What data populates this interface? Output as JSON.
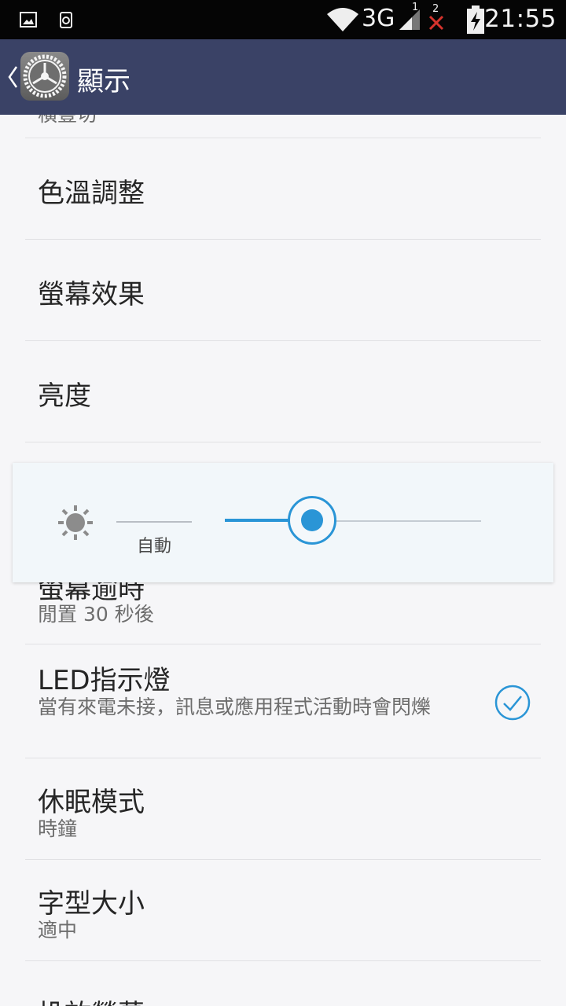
{
  "status_bar": {
    "network": "3G",
    "sim2_badge": "2",
    "signal_badge": "1",
    "time": "21:55"
  },
  "app_bar": {
    "title": "顯示"
  },
  "settings": {
    "partial_top_label": "橫豎切",
    "color_temp": {
      "title": "色溫調整"
    },
    "screen_effect": {
      "title": "螢幕效果"
    },
    "brightness": {
      "title": "亮度"
    },
    "screen_timeout": {
      "title": "螢幕逾時",
      "summary": "閒置 30 秒後"
    },
    "led": {
      "title": "LED指示燈",
      "summary": "當有來電未接，訊息或應用程式活動時會閃爍",
      "checked": true
    },
    "daydream": {
      "title": "休眠模式",
      "summary": "時鐘"
    },
    "font_size": {
      "title": "字型大小",
      "summary": "適中"
    },
    "partial_bottom_label": "投放螢幕"
  },
  "brightness_dialog": {
    "auto_label": "自動",
    "level_fraction": 0.34
  },
  "colors": {
    "app_bar": "#3a4266",
    "accent": "#2a95d6",
    "status_bar": "#050505"
  },
  "icons": {
    "back": "chevron-left-icon",
    "app": "settings-gear-icon",
    "brightness": "sun-icon",
    "checkbox": "check-circle-icon"
  }
}
